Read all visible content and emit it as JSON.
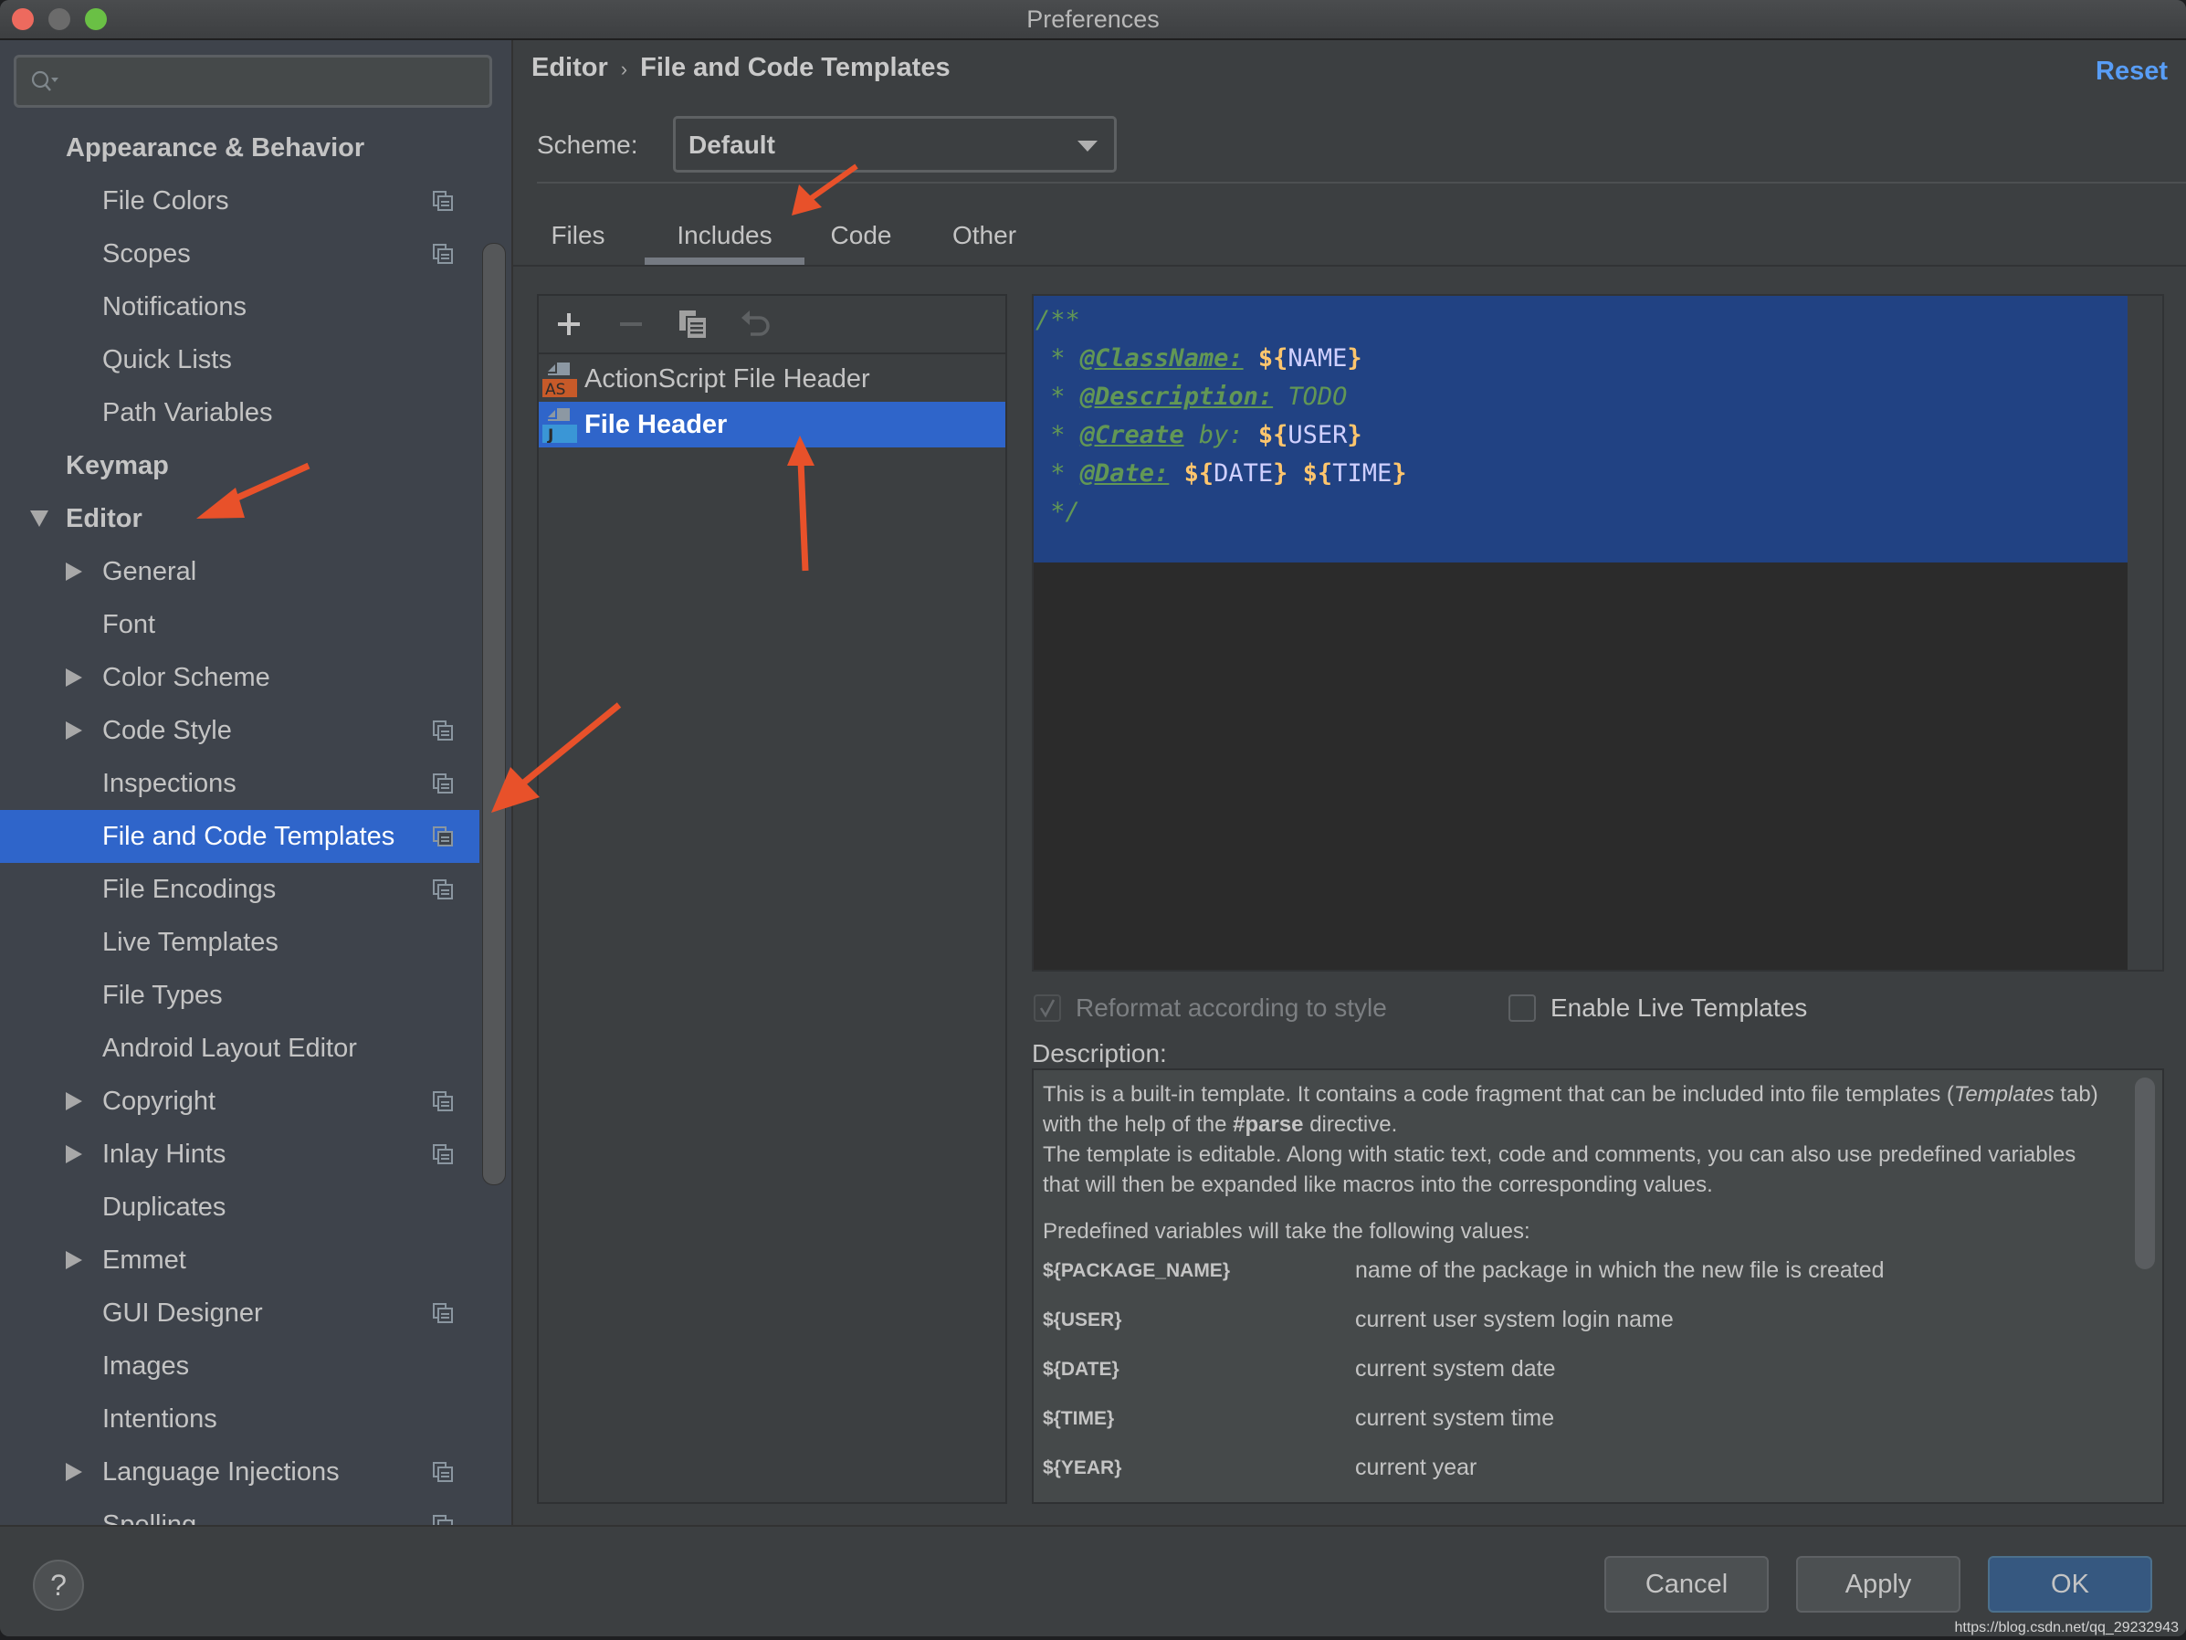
{
  "window": {
    "title": "Preferences"
  },
  "search": {
    "placeholder": "",
    "value": ""
  },
  "sidebar": {
    "items": [
      {
        "label": "Appearance & Behavior",
        "level": 0,
        "bold": true,
        "expander": "none",
        "project_icon": false
      },
      {
        "label": "File Colors",
        "level": 1,
        "bold": false,
        "expander": "none",
        "project_icon": true
      },
      {
        "label": "Scopes",
        "level": 1,
        "bold": false,
        "expander": "none",
        "project_icon": true
      },
      {
        "label": "Notifications",
        "level": 1,
        "bold": false,
        "expander": "none",
        "project_icon": false
      },
      {
        "label": "Quick Lists",
        "level": 1,
        "bold": false,
        "expander": "none",
        "project_icon": false
      },
      {
        "label": "Path Variables",
        "level": 1,
        "bold": false,
        "expander": "none",
        "project_icon": false
      },
      {
        "label": "Keymap",
        "level": 0,
        "bold": true,
        "expander": "none",
        "project_icon": false
      },
      {
        "label": "Editor",
        "level": 0,
        "bold": true,
        "expander": "expanded",
        "project_icon": false
      },
      {
        "label": "General",
        "level": 1,
        "bold": false,
        "expander": "collapsed",
        "project_icon": false
      },
      {
        "label": "Font",
        "level": 1,
        "bold": false,
        "expander": "none",
        "project_icon": false
      },
      {
        "label": "Color Scheme",
        "level": 1,
        "bold": false,
        "expander": "collapsed",
        "project_icon": false
      },
      {
        "label": "Code Style",
        "level": 1,
        "bold": false,
        "expander": "collapsed",
        "project_icon": true
      },
      {
        "label": "Inspections",
        "level": 1,
        "bold": false,
        "expander": "none",
        "project_icon": true
      },
      {
        "label": "File and Code Templates",
        "level": 1,
        "bold": false,
        "expander": "none",
        "project_icon": true,
        "selected": true
      },
      {
        "label": "File Encodings",
        "level": 1,
        "bold": false,
        "expander": "none",
        "project_icon": true
      },
      {
        "label": "Live Templates",
        "level": 1,
        "bold": false,
        "expander": "none",
        "project_icon": false
      },
      {
        "label": "File Types",
        "level": 1,
        "bold": false,
        "expander": "none",
        "project_icon": false
      },
      {
        "label": "Android Layout Editor",
        "level": 1,
        "bold": false,
        "expander": "none",
        "project_icon": false
      },
      {
        "label": "Copyright",
        "level": 1,
        "bold": false,
        "expander": "collapsed",
        "project_icon": true
      },
      {
        "label": "Inlay Hints",
        "level": 1,
        "bold": false,
        "expander": "collapsed",
        "project_icon": true
      },
      {
        "label": "Duplicates",
        "level": 1,
        "bold": false,
        "expander": "none",
        "project_icon": false
      },
      {
        "label": "Emmet",
        "level": 1,
        "bold": false,
        "expander": "collapsed",
        "project_icon": false
      },
      {
        "label": "GUI Designer",
        "level": 1,
        "bold": false,
        "expander": "none",
        "project_icon": true
      },
      {
        "label": "Images",
        "level": 1,
        "bold": false,
        "expander": "none",
        "project_icon": false
      },
      {
        "label": "Intentions",
        "level": 1,
        "bold": false,
        "expander": "none",
        "project_icon": false
      },
      {
        "label": "Language Injections",
        "level": 1,
        "bold": false,
        "expander": "collapsed",
        "project_icon": true
      },
      {
        "label": "Spelling",
        "level": 1,
        "bold": false,
        "expander": "none",
        "project_icon": true
      }
    ]
  },
  "header": {
    "breadcrumb": [
      "Editor",
      "File and Code Templates"
    ],
    "breadcrumb_separator": "›",
    "reset_label": "Reset"
  },
  "scheme": {
    "label": "Scheme:",
    "value": "Default"
  },
  "tabs": [
    {
      "label": "Files",
      "active": false
    },
    {
      "label": "Includes",
      "active": true
    },
    {
      "label": "Code",
      "active": false
    },
    {
      "label": "Other",
      "active": false
    }
  ],
  "template_list": {
    "toolbar": [
      "add-icon",
      "remove-icon",
      "copy-icon",
      "reset-icon"
    ],
    "items": [
      {
        "label": "ActionScript File Header",
        "badge": "AS",
        "badge_color": "#c75a29",
        "selected": false
      },
      {
        "label": "File Header",
        "badge": "J",
        "badge_color": "#3a96d6",
        "selected": true
      }
    ]
  },
  "editor": {
    "lines": [
      [
        {
          "t": "/**",
          "c": "cmt"
        }
      ],
      [
        {
          "t": " * ",
          "c": "cmt"
        },
        {
          "t": "@ClassName:",
          "c": "tag"
        },
        {
          "t": " ",
          "c": "cmt"
        },
        {
          "t": "${",
          "c": "var"
        },
        {
          "t": "NAME",
          "c": "name"
        },
        {
          "t": "}",
          "c": "var"
        }
      ],
      [
        {
          "t": " * ",
          "c": "cmt"
        },
        {
          "t": "@Description:",
          "c": "tag"
        },
        {
          "t": " TODO",
          "c": "cmt"
        }
      ],
      [
        {
          "t": " * ",
          "c": "cmt"
        },
        {
          "t": "@Create",
          "c": "tag"
        },
        {
          "t": " by: ",
          "c": "cmt"
        },
        {
          "t": "${",
          "c": "var"
        },
        {
          "t": "USER",
          "c": "name"
        },
        {
          "t": "}",
          "c": "var"
        }
      ],
      [
        {
          "t": " * ",
          "c": "cmt"
        },
        {
          "t": "@Date:",
          "c": "tag"
        },
        {
          "t": " ",
          "c": "cmt"
        },
        {
          "t": "${",
          "c": "var"
        },
        {
          "t": "DATE",
          "c": "name"
        },
        {
          "t": "}",
          "c": "var"
        },
        {
          "t": " ",
          "c": "cmt"
        },
        {
          "t": "${",
          "c": "var"
        },
        {
          "t": "TIME",
          "c": "name"
        },
        {
          "t": "}",
          "c": "var"
        }
      ],
      [
        {
          "t": " */",
          "c": "cmt"
        }
      ]
    ],
    "selection_bg": "#214283"
  },
  "options": {
    "reformat": {
      "label": "Reformat according to style",
      "checked": true,
      "enabled": false
    },
    "live_templates": {
      "label": "Enable Live Templates",
      "checked": false,
      "enabled": true
    }
  },
  "description": {
    "label": "Description:",
    "para1_a": "This is a built-in template. It contains a code fragment that can be included into file templates (",
    "para1_italic": "Templates",
    "para1_b": " tab) with the help of the ",
    "para1_bold": "#parse",
    "para1_c": " directive.",
    "para1_d": "The template is editable. Along with static text, code and comments, you can also use predefined variables that will then be expanded like macros into the corresponding values.",
    "para2": "Predefined variables will take the following values:",
    "variables": [
      {
        "name": "${PACKAGE_NAME}",
        "desc": "name of the package in which the new file is created"
      },
      {
        "name": "${USER}",
        "desc": "current user system login name"
      },
      {
        "name": "${DATE}",
        "desc": "current system date"
      },
      {
        "name": "${TIME}",
        "desc": "current system time"
      },
      {
        "name": "${YEAR}",
        "desc": "current year"
      }
    ]
  },
  "footer": {
    "help_label": "?",
    "cancel_label": "Cancel",
    "apply_label": "Apply",
    "ok_label": "OK",
    "watermark": "https://blog.csdn.net/qq_29232943"
  },
  "colors": {
    "accent": "#2f65ca",
    "link": "#589df6",
    "primary_button": "#365880",
    "annotation_arrow": "#e8512a"
  }
}
